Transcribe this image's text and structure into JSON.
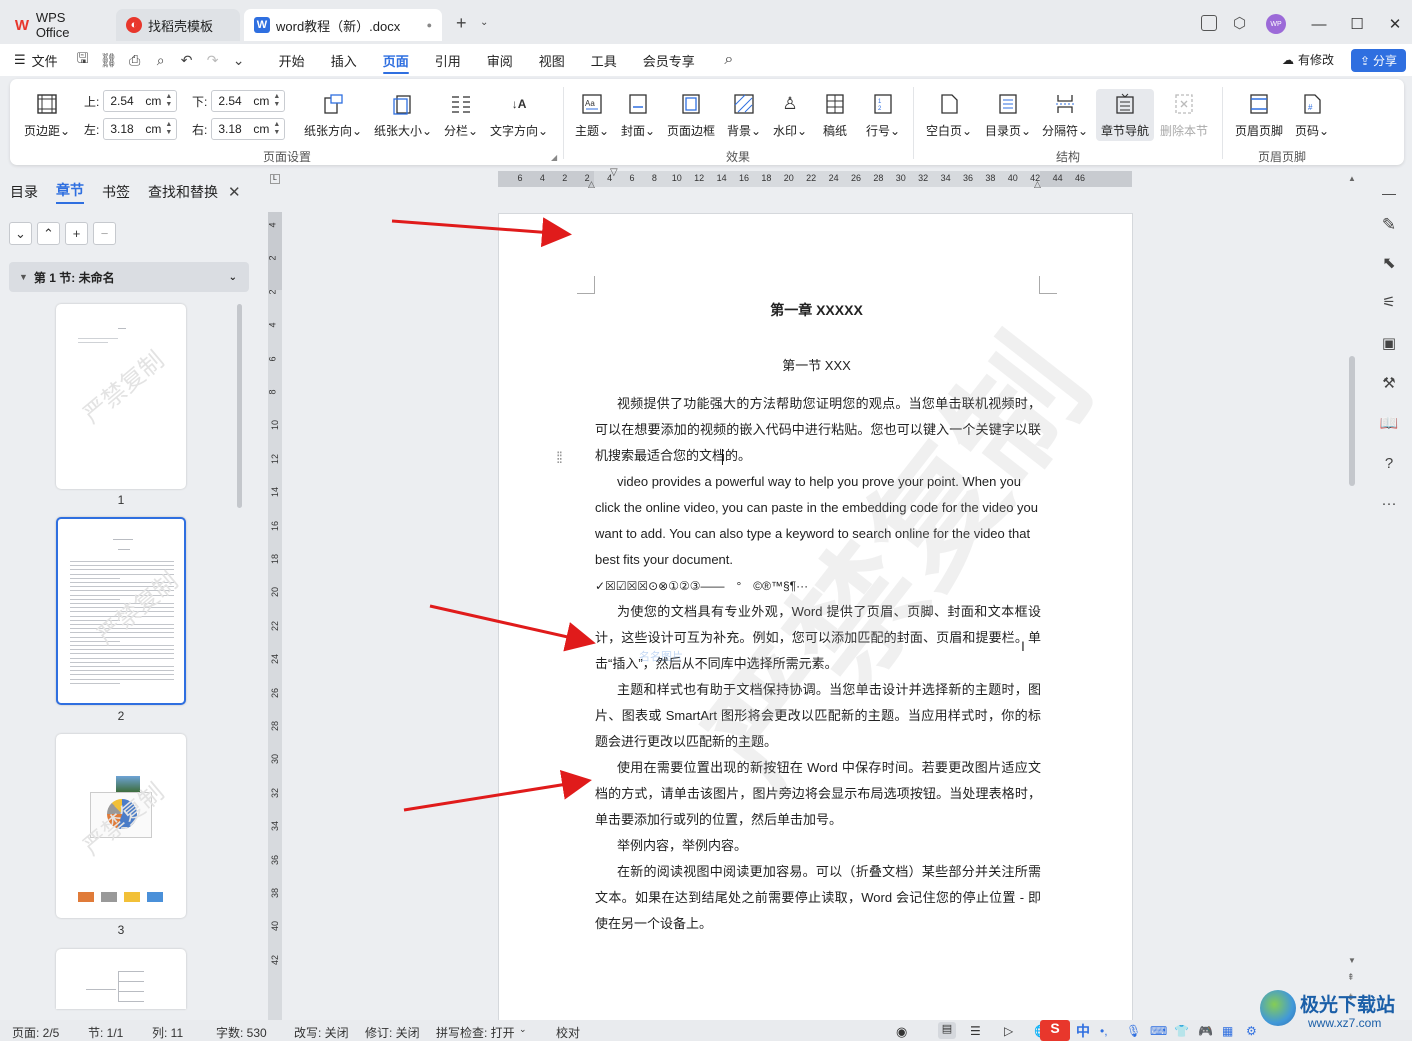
{
  "titlebar": {
    "wps_tab": "WPS Office",
    "template_tab": "找稻壳模板",
    "doc_tab": "word教程（新）.docx",
    "new_tab_symbol": "+",
    "avatar_text": "WP",
    "tab_dot": "●"
  },
  "menubar": {
    "file_label": "文件",
    "tabs": [
      "开始",
      "插入",
      "页面",
      "引用",
      "审阅",
      "视图",
      "工具",
      "会员专享"
    ],
    "active_tab": "页面",
    "modified_label": "有修改",
    "share_label": "分享"
  },
  "ribbon": {
    "margins_label": "页边距",
    "top_label": "上:",
    "top_value": "2.54",
    "bottom_label": "下:",
    "bottom_value": "2.54",
    "left_label": "左:",
    "left_value": "3.18",
    "right_label": "右:",
    "right_value": "3.18",
    "unit": "cm",
    "orientation": "纸张方向",
    "size": "纸张大小",
    "columns": "分栏",
    "text_direction": "文字方向",
    "theme": "主题",
    "cover": "封面",
    "page_border": "页面边框",
    "background": "背景",
    "watermark": "水印",
    "manuscript": "稿纸",
    "line_number": "行号",
    "blank_page": "空白页",
    "toc_page": "目录页",
    "separator": "分隔符",
    "section_nav": "章节导航",
    "delete_section": "删除本节",
    "header_footer": "页眉页脚",
    "page_number": "页码",
    "groups": {
      "page_setup": "页面设置",
      "effects": "效果",
      "structure": "结构",
      "header_footer": "页眉页脚"
    }
  },
  "leftpanel": {
    "tabs": [
      "目录",
      "章节",
      "书签",
      "查找和替换"
    ],
    "active_tab": "章节",
    "close_symbol": "✕",
    "section_title": "第 1 节: 未命名",
    "thumbnails": [
      {
        "number": "1",
        "selected": false,
        "watermark": "严禁复制"
      },
      {
        "number": "2",
        "selected": true,
        "watermark": "严禁复制"
      },
      {
        "number": "3",
        "selected": false,
        "watermark": "严禁复制"
      },
      {
        "number": "",
        "selected": false,
        "watermark": ""
      }
    ]
  },
  "ruler": {
    "h_ticks": [
      "6",
      "4",
      "2",
      "2",
      "4",
      "6",
      "8",
      "10",
      "12",
      "14",
      "16",
      "18",
      "20",
      "22",
      "24",
      "26",
      "28",
      "30",
      "32",
      "34",
      "36",
      "38",
      "40",
      "42",
      "44",
      "46"
    ],
    "v_ticks": [
      "4",
      "2",
      "2",
      "4",
      "6",
      "8",
      "10",
      "12",
      "14",
      "16",
      "18",
      "20",
      "22",
      "24",
      "26",
      "28",
      "30",
      "32",
      "34",
      "36",
      "38",
      "40",
      "42"
    ]
  },
  "document": {
    "chapter_title": "第一章 XXXXX",
    "section_title": "第一节 XXX",
    "paragraphs": [
      "视频提供了功能强大的方法帮助您证明您的观点。当您单击联机视频时，可以在想要添加的视频的嵌入代码中进行粘贴。您也可以键入一个关键字以联机搜索最适合您的文档的。",
      "video provides a powerful way to help you prove your point. When you click the online video, you can paste in the embedding code for the video you want to add. You can also type a keyword to search online for the video that best fits your document.",
      "✓☒☑☒☒⊙⊗①②③——　°　©®™§¶···",
      "为使您的文档具有专业外观，Word 提供了页眉、页脚、封面和文本框设计，这些设计可互为补充。例如，您可以添加匹配的封面、页眉和提要栏。单击“插入”，然后从不同库中选择所需元素。",
      "主题和样式也有助于文档保持协调。当您单击设计并选择新的主题时，图片、图表或 SmartArt 图形将会更改以匹配新的主题。当应用样式时，你的标题会进行更改以匹配新的主题。",
      "使用在需要位置出现的新按钮在 Word 中保存时间。若要更改图片适应文档的方式，请单击该图片，图片旁边将会显示布局选项按钮。当处理表格时，单击要添加行或列的位置，然后单击加号。",
      "举例内容，举例内容。",
      "在新的阅读视图中阅读更加容易。可以（折叠文档）某些部分并关注所需文本。如果在达到结尾处之前需要停止读取，Word 会记住您的停止位置 - 即使在另一个设备上。"
    ],
    "watermark": "严禁复制",
    "faint_mark": "名名图片"
  },
  "statusbar": {
    "page": "页面: 2/5",
    "section": "节: 1/1",
    "column": "列: 11",
    "word_count": "字数: 530",
    "overtype": "改写: 关闭",
    "track_changes": "修订: 关闭",
    "spellcheck": "拼写检查: 打开",
    "proofread": "校对",
    "ime": "中"
  },
  "brand": {
    "site_name": "极光下载站",
    "site_url": "www.xz7.com"
  },
  "colors": {
    "accent": "#2f6fe0",
    "arrow": "#e01b1b",
    "wps_red": "#e8372c"
  }
}
